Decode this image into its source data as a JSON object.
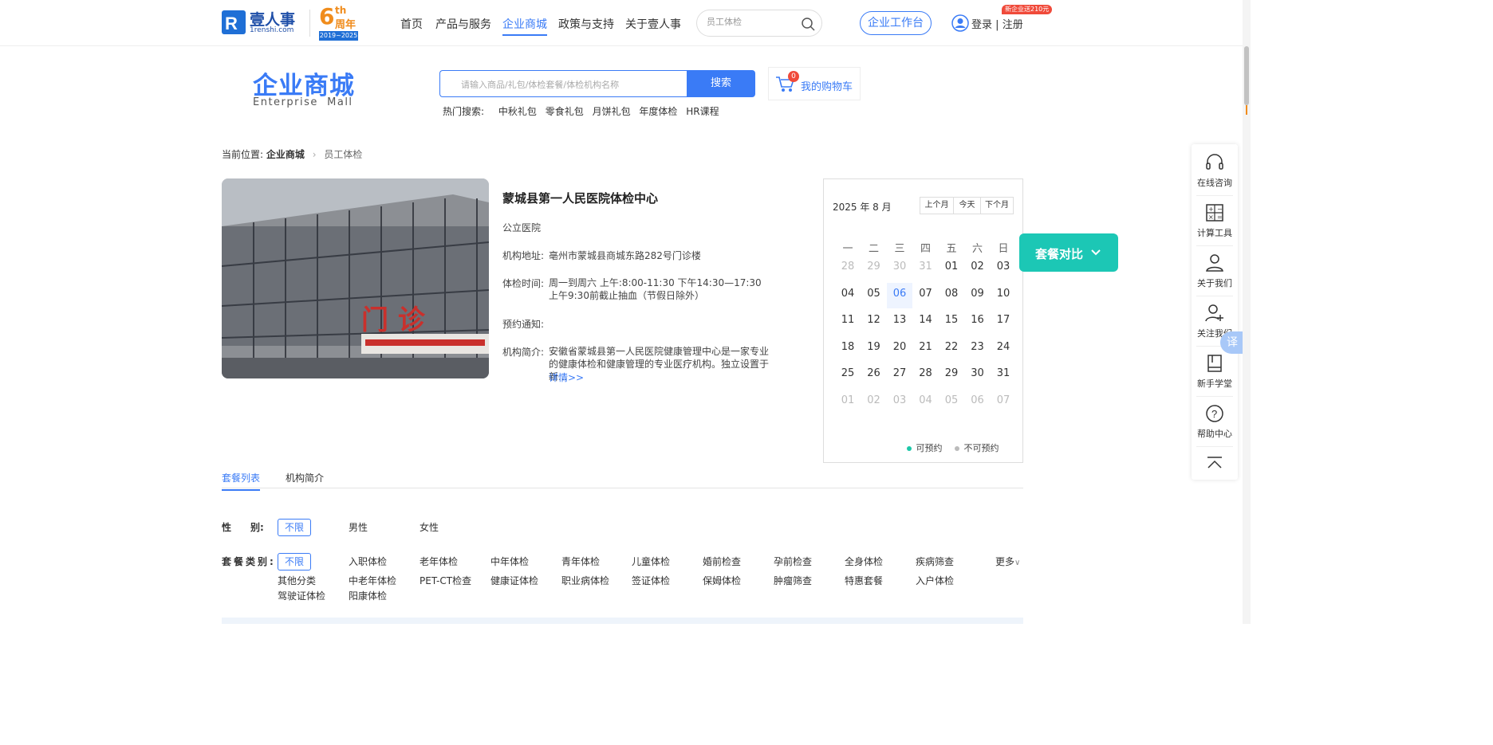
{
  "header": {
    "logo_text": "壹人事",
    "logo_sub": "1renshi.com",
    "anniv_main": "6",
    "anniv_th": "th",
    "anniv_cn": "周年",
    "anniv_years": "2019~2025",
    "nav": [
      "首页",
      "产品与服务",
      "企业商城",
      "政策与支持",
      "关于壹人事"
    ],
    "search_placeholder": "员工体检",
    "workbench": "企业工作台",
    "promo_badge": "新企业送210元",
    "login": "登录",
    "sep": "|",
    "register": "注册",
    "accent": "#3a7bf6"
  },
  "mall": {
    "title": "企业商城",
    "subtitle": "Enterprise  Mall",
    "search_placeholder": "请输入商品/礼包/体检套餐/体检机构名称",
    "search_btn": "搜索",
    "cart_count": "0",
    "cart_label": "我的购物车",
    "hot_label": "热门搜索:",
    "hot": [
      "中秋礼包",
      "零食礼包",
      "月饼礼包",
      "年度体检",
      "HR课程"
    ]
  },
  "breadcrumb": {
    "prefix": "当前位置:",
    "level1": "企业商城",
    "level2": "员工体检"
  },
  "institution": {
    "name": "蒙城县第一人民医院体检中心",
    "type": "公立医院",
    "address_label": "机构地址:",
    "address": "亳州市蒙城县商城东路282号门诊楼",
    "hours_label": "体检时间:",
    "hours": "周一到周六 上午:8:00-11:30 下午14:30—17:30 上午9:30前截止抽血（节假日除外）",
    "notice_label": "预约通知:",
    "intro_label": "机构简介:",
    "intro": "安徽省蒙城县第一人民医院健康管理中心是一家专业的健康体检和健康管理的专业医疗机构。独立设置于新...",
    "more": "详情>>",
    "photo_sign": "门 诊"
  },
  "calendar": {
    "month_label": "2025 年 8 月",
    "prev": "上个月",
    "today": "今天",
    "next": "下个月",
    "weekdays": [
      "一",
      "二",
      "三",
      "四",
      "五",
      "六",
      "日"
    ],
    "weeks": [
      [
        "28",
        "29",
        "30",
        "31",
        "01",
        "02",
        "03"
      ],
      [
        "04",
        "05",
        "06",
        "07",
        "08",
        "09",
        "10"
      ],
      [
        "11",
        "12",
        "13",
        "14",
        "15",
        "16",
        "17"
      ],
      [
        "18",
        "19",
        "20",
        "21",
        "22",
        "23",
        "24"
      ],
      [
        "25",
        "26",
        "27",
        "28",
        "29",
        "30",
        "31"
      ],
      [
        "01",
        "02",
        "03",
        "04",
        "05",
        "06",
        "07"
      ]
    ],
    "legend_available": "可预约",
    "legend_unavailable": "不可预约",
    "available_color": "#1cc7a8"
  },
  "compare_btn": "套餐对比",
  "tabs": [
    "套餐列表",
    "机构简介"
  ],
  "filters": {
    "gender_label": "性　　别:",
    "gender": [
      "不限",
      "男性",
      "女性"
    ],
    "category_label": "套餐类别:",
    "category_row1": [
      "不限",
      "入职体检",
      "老年体检",
      "中年体检",
      "青年体检",
      "儿童体检",
      "婚前检查",
      "孕前检查",
      "全身体检",
      "疾病筛查"
    ],
    "category_row2": [
      "其他分类",
      "中老年体检",
      "PET-CT检查",
      "健康证体检",
      "职业病体检",
      "签证体检",
      "保姆体检",
      "肿瘤筛查",
      "特惠套餐",
      "入户体检"
    ],
    "category_row3": [
      "驾驶证体检",
      "阳康体检"
    ],
    "more": "更多"
  },
  "sidebar": {
    "items": [
      "在线咨询",
      "计算工具",
      "关于我们",
      "关注我们",
      "新手学堂",
      "帮助中心"
    ],
    "translate": "译"
  }
}
